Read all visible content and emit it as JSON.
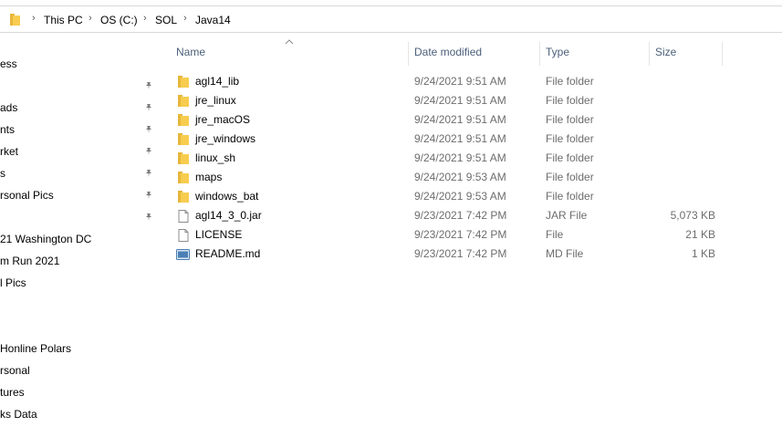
{
  "breadcrumb": [
    "This PC",
    "OS (C:)",
    "SOL",
    "Java14"
  ],
  "nav_items": [
    {
      "label": "ess",
      "pinned": false
    },
    {
      "label": "",
      "pinned": true
    },
    {
      "label": "ads",
      "pinned": true
    },
    {
      "label": "nts",
      "pinned": true
    },
    {
      "label": "rket",
      "pinned": true
    },
    {
      "label": "s",
      "pinned": true
    },
    {
      "label": "rsonal Pics",
      "pinned": true
    },
    {
      "label": "",
      "pinned": true
    },
    {
      "label": "21 Washington DC",
      "pinned": false
    },
    {
      "label": "m Run 2021",
      "pinned": false
    },
    {
      "label": "l Pics",
      "pinned": false
    },
    {
      "label": "",
      "pinned": false
    },
    {
      "label": "",
      "pinned": false
    },
    {
      "label": "Honline Polars",
      "pinned": false
    },
    {
      "label": "rsonal",
      "pinned": false
    },
    {
      "label": "tures",
      "pinned": false
    },
    {
      "label": "ks Data",
      "pinned": false
    }
  ],
  "columns": {
    "name": "Name",
    "date": "Date modified",
    "type": "Type",
    "size": "Size"
  },
  "files": [
    {
      "name": "agl14_lib",
      "date": "9/24/2021 9:51 AM",
      "type": "File folder",
      "size": "",
      "icon": "folder-icon"
    },
    {
      "name": "jre_linux",
      "date": "9/24/2021 9:51 AM",
      "type": "File folder",
      "size": "",
      "icon": "folder-icon"
    },
    {
      "name": "jre_macOS",
      "date": "9/24/2021 9:51 AM",
      "type": "File folder",
      "size": "",
      "icon": "folder-icon"
    },
    {
      "name": "jre_windows",
      "date": "9/24/2021 9:51 AM",
      "type": "File folder",
      "size": "",
      "icon": "folder-icon"
    },
    {
      "name": "linux_sh",
      "date": "9/24/2021 9:51 AM",
      "type": "File folder",
      "size": "",
      "icon": "folder-icon"
    },
    {
      "name": "maps",
      "date": "9/24/2021 9:53 AM",
      "type": "File folder",
      "size": "",
      "icon": "folder-icon"
    },
    {
      "name": "windows_bat",
      "date": "9/24/2021 9:53 AM",
      "type": "File folder",
      "size": "",
      "icon": "folder-icon"
    },
    {
      "name": "agl14_3_0.jar",
      "date": "9/23/2021 7:42 PM",
      "type": "JAR File",
      "size": "5,073 KB",
      "icon": "file-icon"
    },
    {
      "name": "LICENSE",
      "date": "9/23/2021 7:42 PM",
      "type": "File",
      "size": "21 KB",
      "icon": "file-icon"
    },
    {
      "name": "README.md",
      "date": "9/23/2021 7:42 PM",
      "type": "MD File",
      "size": "1 KB",
      "icon": "markdown-file-icon"
    }
  ],
  "colors": {
    "folder": "#f8cd4f",
    "folder_dark": "#e7b73a",
    "header_text": "#4c607a",
    "meta_text": "#6d6d6d"
  }
}
